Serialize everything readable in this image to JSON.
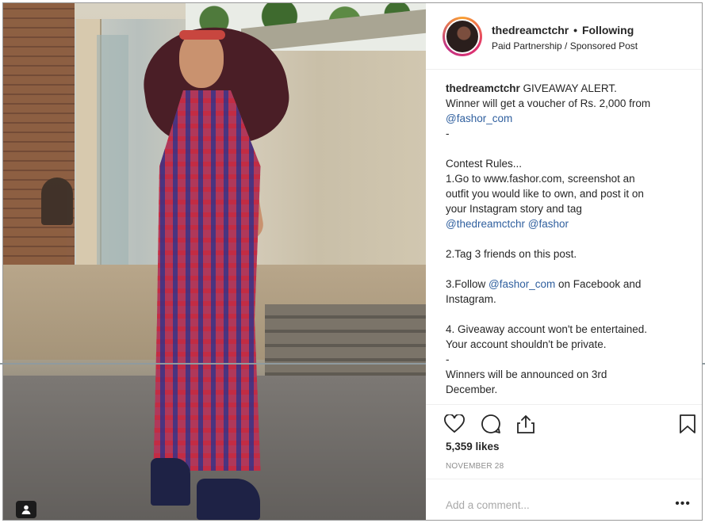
{
  "post": {
    "username": "thedreamctchr",
    "separator": "•",
    "follow_status": "Following",
    "subtitle": "Paid Partnership / Sponsored Post"
  },
  "caption": {
    "line1_user": "thedreamctchr",
    "line1_text": " GIVEAWAY ALERT.",
    "line2": "Winner will get a voucher of Rs. 2,000 from",
    "line3_mention": "@fashor_com",
    "line4": "-",
    "line5": "Contest Rules...",
    "line6": "1.Go to www.fashor.com, screenshot an",
    "line7": "outfit you would like to own, and post it on",
    "line8": "your Instagram story and tag",
    "line9_mention1": "@thedreamctchr",
    "line9_mention2": "@fashor",
    "line10": "2.Tag 3 friends on this post.",
    "line11_pre": "3.Follow ",
    "line11_mention": "@fashor_com",
    "line11_post": " on Facebook and",
    "line12": "Instagram.",
    "line13": "4. Giveaway account won't be entertained.",
    "line14": "Your account shouldn't be private.",
    "line15": "-",
    "line16": "Winners will be announced on 3rd",
    "line17": "December."
  },
  "stats": {
    "likes": "5,359 likes",
    "date": "NOVEMBER 28"
  },
  "comment": {
    "placeholder": "Add a comment...",
    "more": "•••"
  },
  "icons": {
    "like": "heart-icon",
    "comment": "comment-icon",
    "share": "share-icon",
    "save": "bookmark-icon",
    "tag": "person-tag-icon"
  },
  "colors": {
    "link": "#2f5f9e",
    "text": "#262626",
    "muted": "#8e8e8e"
  }
}
